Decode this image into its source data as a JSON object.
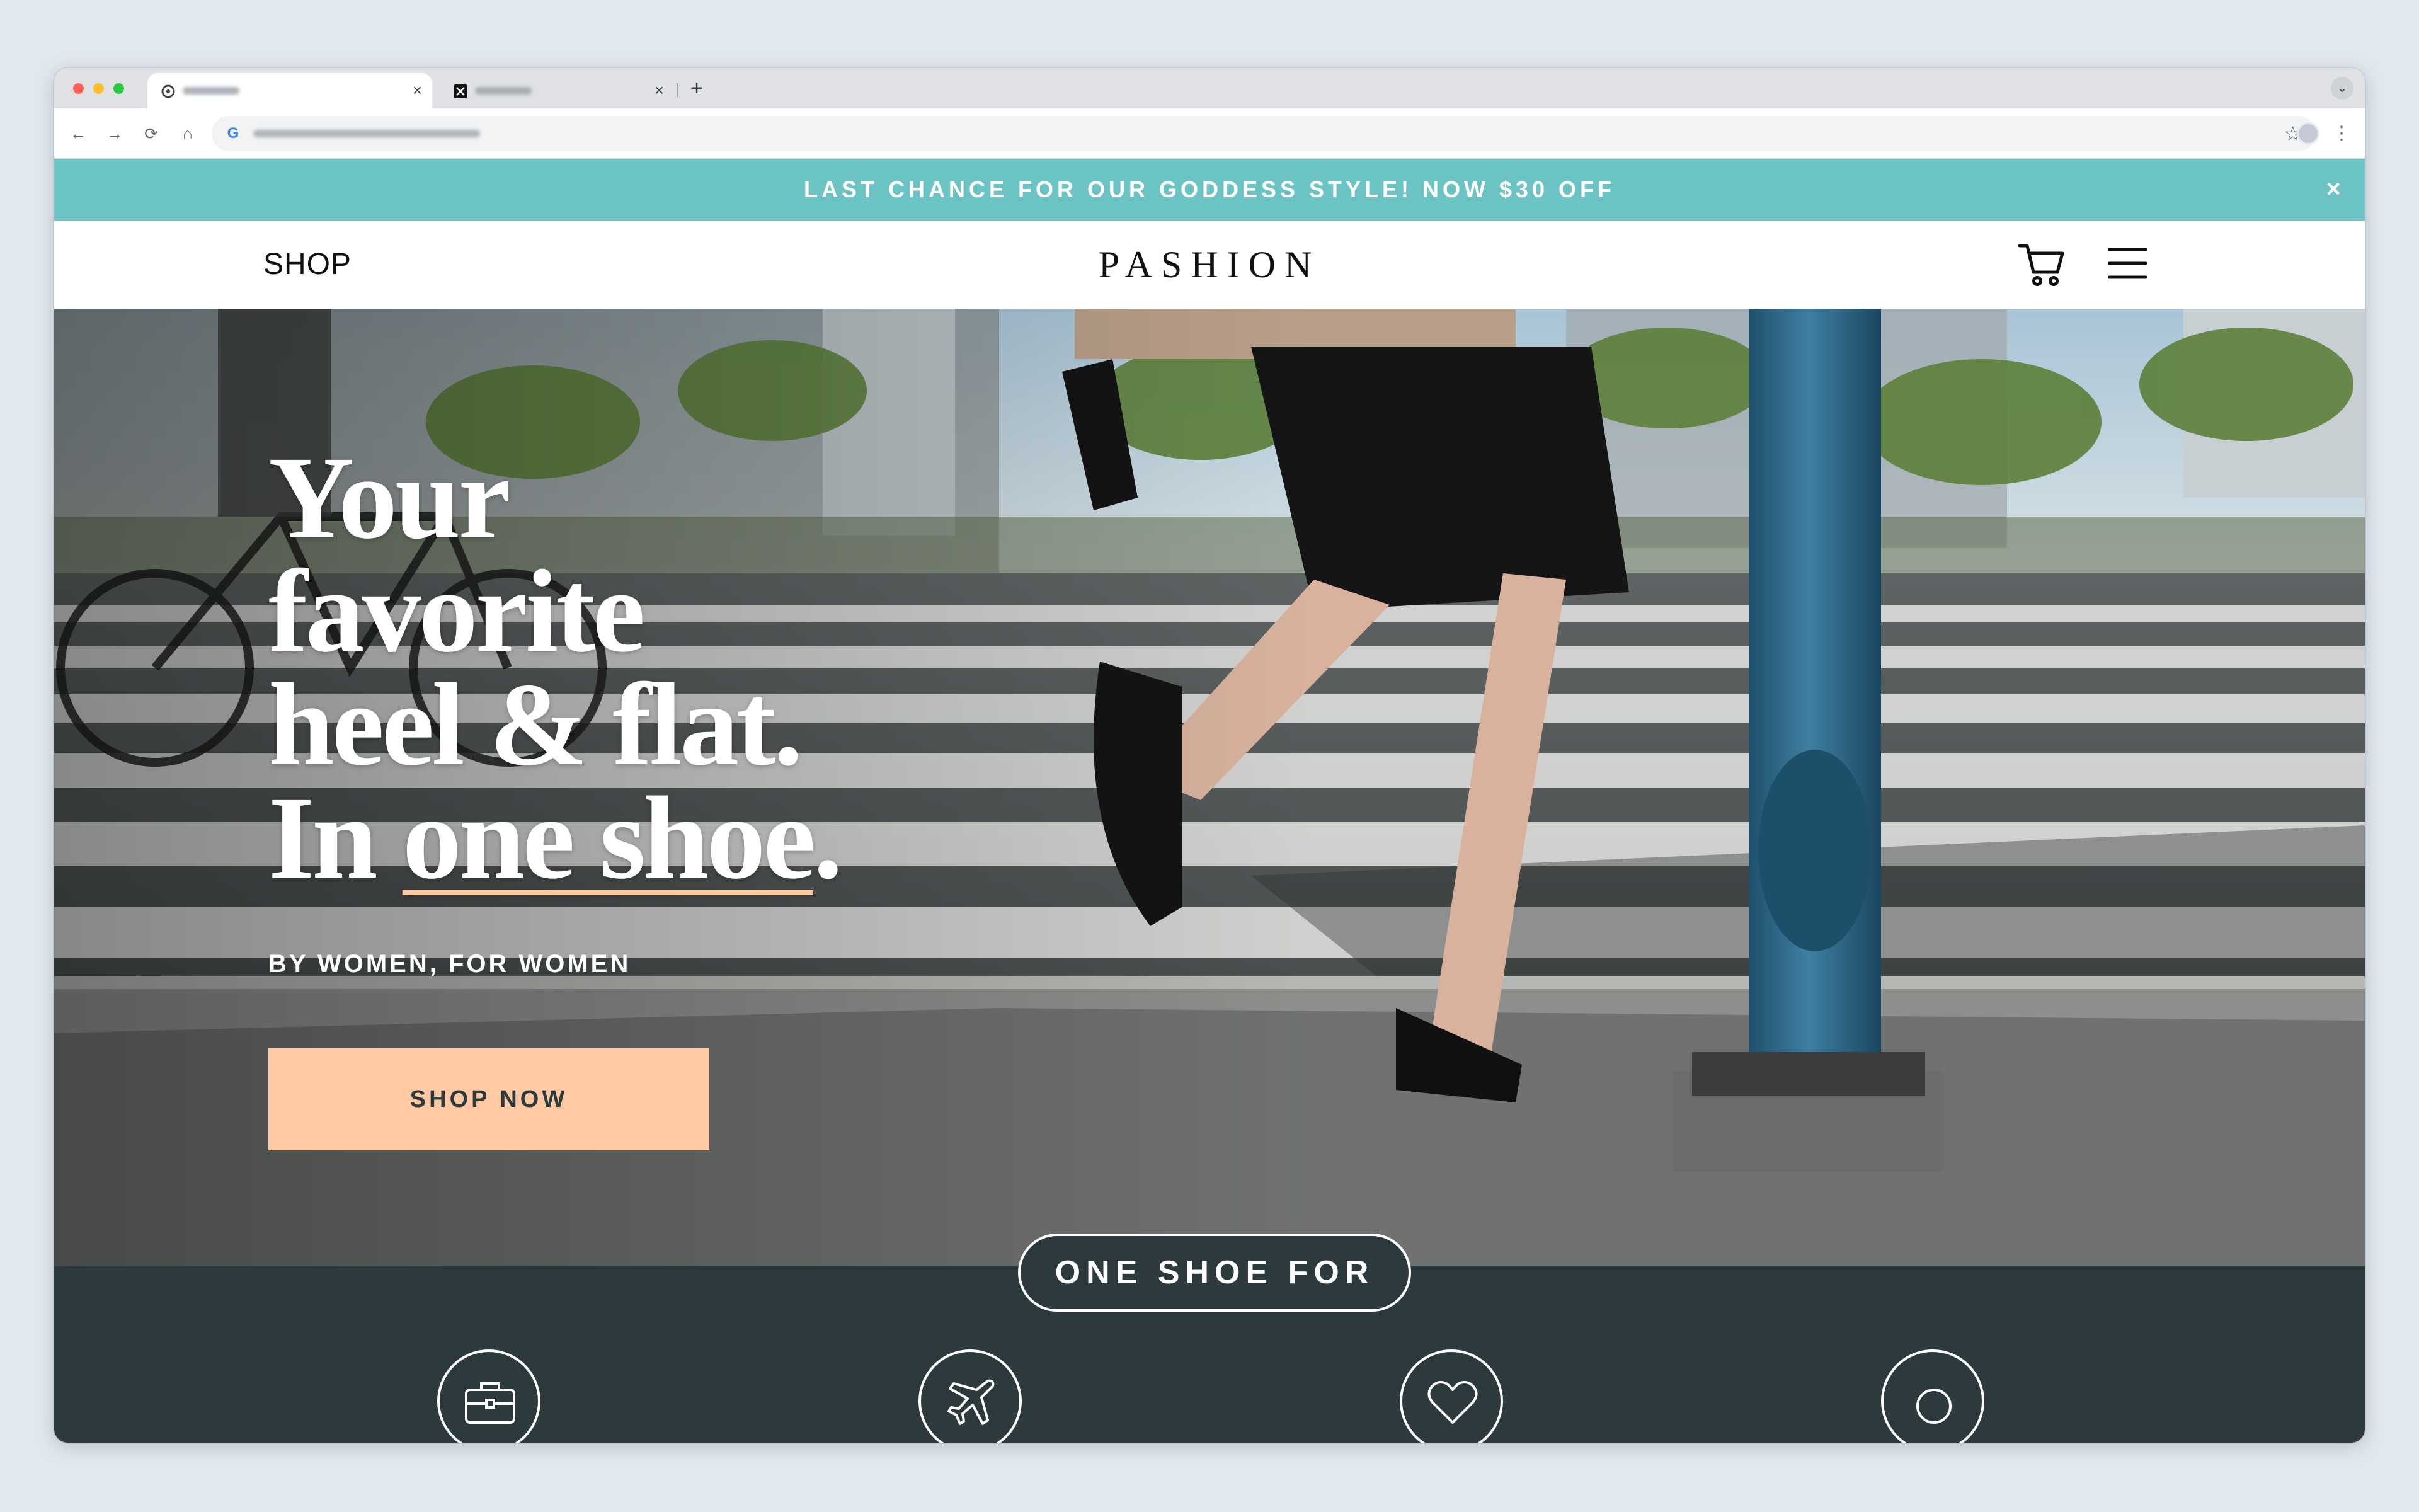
{
  "browser": {
    "tabs": [
      {
        "name": "tab-1",
        "close_glyph": "×"
      },
      {
        "name": "tab-2",
        "close_glyph": "×"
      }
    ],
    "new_tab_glyph": "+",
    "nav_glyphs": {
      "back": "←",
      "forward": "→",
      "reload": "⟳",
      "home": "⌂"
    },
    "omnibox_icon_glyph": "G",
    "bookmark_glyph": "☆",
    "menu_glyph": "⋮",
    "tab_menu_glyph": "⌄",
    "colors": {
      "tabstrip": "#dfe1e5",
      "toolbar": "#ffffff"
    }
  },
  "announcement": {
    "text": "LAST CHANCE FOR OUR GODDESS STYLE! NOW $30 OFF",
    "close_glyph": "×",
    "bg_color": "#6cc3c3"
  },
  "nav": {
    "shop_label": "SHOP",
    "brand": "PASHION",
    "icons": [
      "cart-icon",
      "hamburger-menu-icon"
    ]
  },
  "hero": {
    "headline_lines": [
      "Your",
      "favorite",
      "heel & flat."
    ],
    "headline_last_prefix": "In ",
    "headline_last_underlined": "one shoe",
    "headline_last_suffix": ".",
    "subhead": "BY WOMEN, FOR WOMEN",
    "cta_label": "SHOP NOW",
    "cta_color": "#ffc9a3",
    "underline_color": "#ffcaa2"
  },
  "one_shoe_for": {
    "label": "ONE SHOE FOR",
    "icons": [
      "briefcase-icon",
      "airplane-icon",
      "heart-icon",
      "ring-icon"
    ],
    "bg_color": "#2d3a3d"
  }
}
